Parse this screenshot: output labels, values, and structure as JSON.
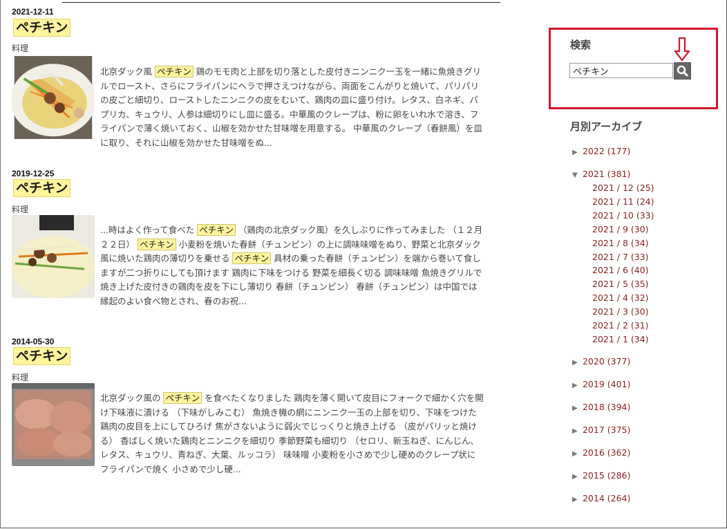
{
  "posts": [
    {
      "date": "2021-12-11",
      "title": "ペチキン",
      "label": "料理",
      "snippet": [
        {
          "t": "北京ダック風 "
        },
        {
          "t": "ペチキン",
          "hl": true
        },
        {
          "t": " 鶏のモモ肉と上部を切り落とした皮付きニンニク一玉を一緒に魚焼きグリルでロースト、さらにフライパンにヘラで押さえつけながら、両面をこんがりと焼いて、パリパリの皮ごと細切り、ローストしたニンニクの皮をむいて、鶏肉の皿に盛り付け。レタス、白ネギ、パプリカ、キュウリ、人参は細切りにし皿に盛る。中華風のクレープは、粉に卵をいれ水で溶き、フライパンで薄く焼いておく、山椒を効かせた甘味噌を用意する。 中華風のクレープ（春餅風）を皿に取り、それに山椒を効かせた甘味噌をぬ..."
        }
      ]
    },
    {
      "date": "2019-12-25",
      "title": "ペチキン",
      "label": "料理",
      "snippet": [
        {
          "t": "...時はよく作って食べた "
        },
        {
          "t": "ペチキン",
          "hl": true
        },
        {
          "t": " （鶏肉の北京ダック風）を久しぶりに作ってみました （１２月２２日） "
        },
        {
          "t": "ペチキン",
          "hl": true
        },
        {
          "t": " 小麦粉を焼いた春餅（チュンピン）の上に調味味噌をぬり、野菜と北京ダック風に焼いた鶏肉の薄切りを乗せる "
        },
        {
          "t": "ペチキン",
          "hl": true
        },
        {
          "t": " 具材の乗った春餅（チュンピン）を端から巻いて食しますが二つ折りにしても頂けます 鶏肉に下味をつける 野菜を細長く切る 調味味噌 魚焼きグリルで焼き上げた皮付きの鶏肉を皮を下にし薄切り 春餅（チュンピン） 春餅（チュンピン）は中国では縁起のよい食べ物とされ、春のお祝..."
        }
      ]
    },
    {
      "date": "2014-05-30",
      "title": "ペチキン",
      "label": "料理",
      "snippet": [
        {
          "t": "北京ダック風の "
        },
        {
          "t": "ペチキン",
          "hl": true
        },
        {
          "t": " を食べたくなりました 鶏肉を薄く開いて皮目にフォークで細かく穴を開け下味液に漬ける （下味がしみこむ） 魚焼き機の網にニンニク一玉の上部を切り、下味をつけた鶏肉の皮目を上にしてひろげ 焦がさないように弱火でじっくりと焼き上げる （皮がパリッと焼ける） 香ばしく焼いた鶏肉とニンニクを細切り 季節野菜も細切り （セロリ、新玉ねぎ、にんじん、レタス、キュウリ、青ねぎ、大葉、ルッコラ） 味味噌 小麦粉を小さめで少し硬めのクレープ状にフライパンで焼く 小さめで少し硬..."
        }
      ]
    }
  ],
  "sidebar": {
    "search_title": "検索",
    "search_value": "ペチキン",
    "archive_title": "月別アーカイブ",
    "years": [
      {
        "label": "2022 (177)",
        "open": false
      },
      {
        "label": "2021 (381)",
        "open": true,
        "months": [
          "2021 / 12 (25)",
          "2021 / 11 (24)",
          "2021 / 10 (33)",
          "2021 / 9 (30)",
          "2021 / 8 (34)",
          "2021 / 7 (33)",
          "2021 / 6 (40)",
          "2021 / 5 (35)",
          "2021 / 4 (32)",
          "2021 / 3 (30)",
          "2021 / 2 (31)",
          "2021 / 1 (34)"
        ]
      },
      {
        "label": "2020 (377)",
        "open": false
      },
      {
        "label": "2019 (401)",
        "open": false
      },
      {
        "label": "2018 (394)",
        "open": false
      },
      {
        "label": "2017 (375)",
        "open": false
      },
      {
        "label": "2016 (362)",
        "open": false
      },
      {
        "label": "2015 (286)",
        "open": false
      },
      {
        "label": "2014 (264)",
        "open": false
      }
    ]
  },
  "icons": {
    "search": "search-icon",
    "arrow": "arrow-down-icon",
    "expanded": "triangle-down-icon",
    "collapsed": "triangle-right-icon"
  },
  "colors": {
    "highlight": "#fff59d",
    "annotation": "#d6152b",
    "link": "#8b1e1e"
  }
}
